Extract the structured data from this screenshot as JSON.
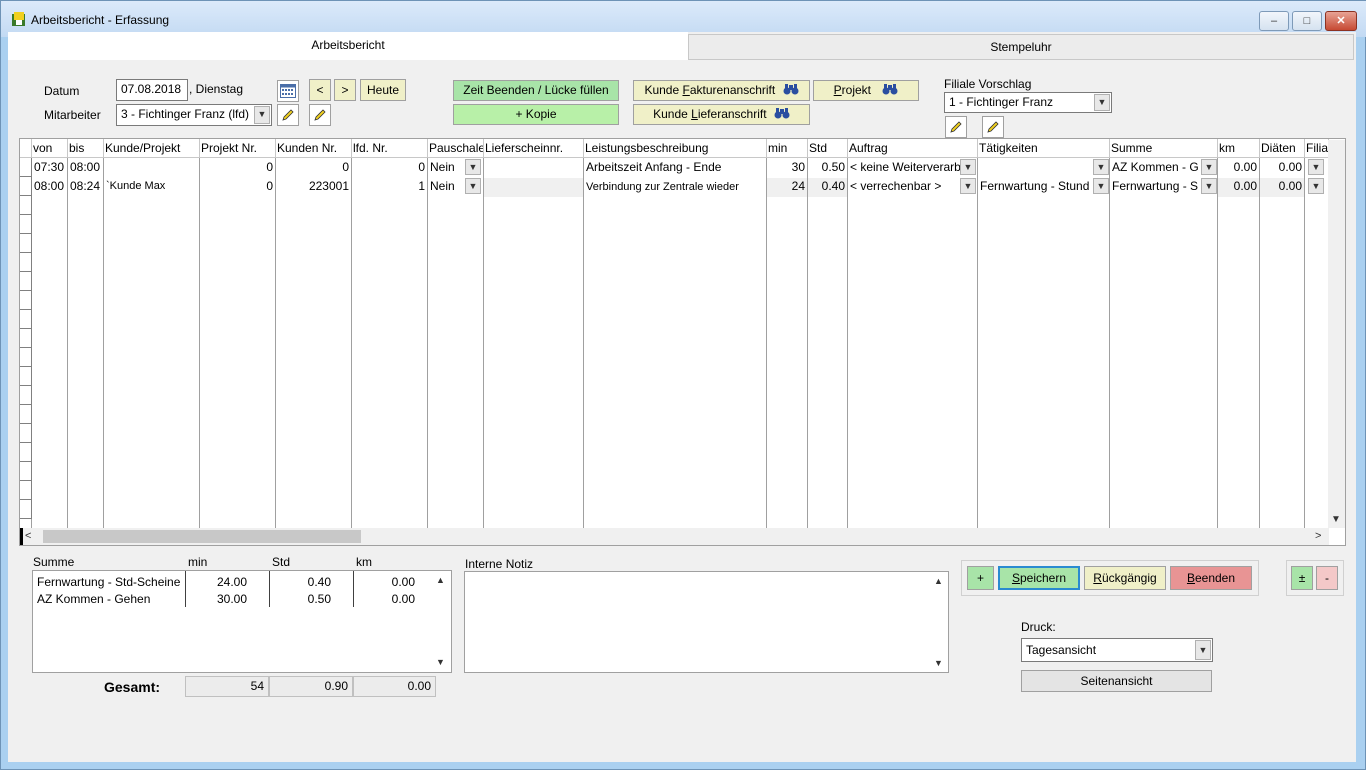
{
  "window": {
    "title": "Arbeitsbericht - Erfassung",
    "controls": {
      "minimize": "–",
      "maximize": "□",
      "close": "✕"
    }
  },
  "tabs": [
    {
      "label": "Arbeitsbericht",
      "active": true
    },
    {
      "label": "Stempeluhr",
      "active": false
    }
  ],
  "form": {
    "datum_label": "Datum",
    "datum_value": "07.08.2018",
    "weekday": ", Dienstag",
    "mitarbeiter_label": "Mitarbeiter",
    "mitarbeiter_value": "3 - Fichtinger Franz (lfd)",
    "prev_label": "<",
    "next_label": ">",
    "heute_label": "Heute",
    "zeit_beenden_label": "Zeit Beenden / Lücke füllen",
    "kopie_label": "+ Kopie",
    "kunde_faktura_prefix": "Kunde ",
    "kunde_faktura_hot": "F",
    "kunde_faktura_rest": "akturenanschrift",
    "kunde_liefer_prefix": "Kunde ",
    "kunde_liefer_hot": "L",
    "kunde_liefer_rest": "ieferanschrift",
    "projekt_hot": "P",
    "projekt_rest": "rojekt",
    "filiale_label": "Filiale Vorschlag",
    "filiale_value": "1 - Fichtinger Franz"
  },
  "grid": {
    "columns": [
      "von",
      "bis",
      "Kunde/Projekt",
      "Projekt Nr.",
      "Kunden Nr.",
      "lfd. Nr.",
      "Pauschale",
      "Lieferscheinnr.",
      "Leistungsbeschreibung",
      "min",
      "Std",
      "Auftrag",
      "Tätigkeiten",
      "Summe",
      "km",
      "Diäten",
      "Filiale"
    ],
    "rows": [
      {
        "von": "07:30",
        "bis": "08:00",
        "kunde": "",
        "projekt_nr": "0",
        "kunden_nr": "0",
        "lfd_nr": "0",
        "pauschale": "Nein",
        "lieferschein": "",
        "leistung": "Arbeitszeit Anfang - Ende",
        "min": "30",
        "std": "0.50",
        "auftrag": "< keine Weiterverarb",
        "taetigkeiten": "",
        "summe": "AZ Kommen - G",
        "km": "0.00",
        "diaeten": "0.00"
      },
      {
        "von": "08:00",
        "bis": "08:24",
        "kunde": "`Kunde Max",
        "projekt_nr": "0",
        "kunden_nr": "223001",
        "lfd_nr": "1",
        "pauschale": "Nein",
        "lieferschein": "",
        "leistung": "Verbindung zur Zentrale wieder",
        "min": "24",
        "std": "0.40",
        "auftrag": "< verrechenbar >",
        "taetigkeiten": "Fernwartung - Stund",
        "summe": "Fernwartung - S",
        "km": "0.00",
        "diaeten": "0.00"
      }
    ]
  },
  "summary": {
    "headers": {
      "summe": "Summe",
      "min": "min",
      "std": "Std",
      "km": "km"
    },
    "rows": [
      {
        "name": "Fernwartung - Std-Scheine",
        "min": "24.00",
        "std": "0.40",
        "km": "0.00"
      },
      {
        "name": "AZ Kommen - Gehen",
        "min": "30.00",
        "std": "0.50",
        "km": "0.00"
      }
    ],
    "gesamt_label": "Gesamt:",
    "gesamt_min": "54",
    "gesamt_std": "0.90",
    "gesamt_km": "0.00"
  },
  "notiz_label": "Interne Notiz",
  "actions": {
    "plus": "+",
    "speichern_hot": "S",
    "speichern_rest": "peichern",
    "rueck_hot": "R",
    "rueck_rest": "ückgängig",
    "beenden_hot": "B",
    "beenden_rest": "eenden",
    "plusminus": "±",
    "minus": "-"
  },
  "druck": {
    "label": "Druck:",
    "value": "Tagesansicht",
    "seitenansicht": "Seitenansicht"
  },
  "colors": {
    "green_button": "#a8e4a8",
    "yellow_button": "#f0f0c8",
    "red_button": "#e89494",
    "window_frame": "#aad0f0"
  }
}
